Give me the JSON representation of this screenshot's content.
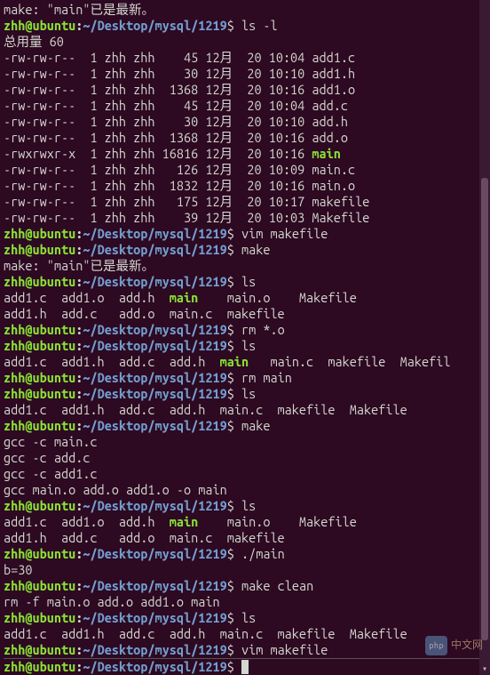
{
  "prompt": {
    "user": "zhh",
    "host": "ubuntu",
    "path": "~/Desktop/mysql/1219",
    "symbol": "$"
  },
  "make_msg": "make: \"main\"已是最新。",
  "ls_total": "总用量 60",
  "ls_l_rows": [
    {
      "perm": "-rw-rw-r--",
      "links": 1,
      "owner": "zhh",
      "group": "zhh",
      "size": "45",
      "month": "12月",
      "day": "20",
      "time": "10:04",
      "name": "add1.c",
      "exec": false
    },
    {
      "perm": "-rw-rw-r--",
      "links": 1,
      "owner": "zhh",
      "group": "zhh",
      "size": "30",
      "month": "12月",
      "day": "20",
      "time": "10:10",
      "name": "add1.h",
      "exec": false
    },
    {
      "perm": "-rw-rw-r--",
      "links": 1,
      "owner": "zhh",
      "group": "zhh",
      "size": "1368",
      "month": "12月",
      "day": "20",
      "time": "10:16",
      "name": "add1.o",
      "exec": false
    },
    {
      "perm": "-rw-rw-r--",
      "links": 1,
      "owner": "zhh",
      "group": "zhh",
      "size": "45",
      "month": "12月",
      "day": "20",
      "time": "10:04",
      "name": "add.c",
      "exec": false
    },
    {
      "perm": "-rw-rw-r--",
      "links": 1,
      "owner": "zhh",
      "group": "zhh",
      "size": "30",
      "month": "12月",
      "day": "20",
      "time": "10:10",
      "name": "add.h",
      "exec": false
    },
    {
      "perm": "-rw-rw-r--",
      "links": 1,
      "owner": "zhh",
      "group": "zhh",
      "size": "1368",
      "month": "12月",
      "day": "20",
      "time": "10:16",
      "name": "add.o",
      "exec": false
    },
    {
      "perm": "-rwxrwxr-x",
      "links": 1,
      "owner": "zhh",
      "group": "zhh",
      "size": "16816",
      "month": "12月",
      "day": "20",
      "time": "10:16",
      "name": "main",
      "exec": true
    },
    {
      "perm": "-rw-rw-r--",
      "links": 1,
      "owner": "zhh",
      "group": "zhh",
      "size": "126",
      "month": "12月",
      "day": "20",
      "time": "10:09",
      "name": "main.c",
      "exec": false
    },
    {
      "perm": "-rw-rw-r--",
      "links": 1,
      "owner": "zhh",
      "group": "zhh",
      "size": "1832",
      "month": "12月",
      "day": "20",
      "time": "10:16",
      "name": "main.o",
      "exec": false
    },
    {
      "perm": "-rw-rw-r--",
      "links": 1,
      "owner": "zhh",
      "group": "zhh",
      "size": "175",
      "month": "12月",
      "day": "20",
      "time": "10:17",
      "name": "makefile",
      "exec": false
    },
    {
      "perm": "-rw-rw-r--",
      "links": 1,
      "owner": "zhh",
      "group": "zhh",
      "size": "39",
      "month": "12月",
      "day": "20",
      "time": "10:03",
      "name": "Makefile",
      "exec": false
    }
  ],
  "cmds": {
    "ls_l": "ls -l",
    "vim_makefile": "vim makefile",
    "make": "make",
    "ls": "ls",
    "rm_o": "rm *.o",
    "rm_main": "rm main",
    "run_main": "./main",
    "make_clean": "make clean"
  },
  "ls_out": {
    "ls1_l1": "add1.c  add1.o  add.h  main    main.o    Makefile",
    "ls1_l2": "add1.h  add.c   add.o  main.c  makefile",
    "ls2": "add1.c  add1.h  add.c  add.h  main  main.c  makefile  Makefil",
    "ls3": "add1.c  add1.h  add.c  add.h  main.c  makefile  Makefile",
    "ls5_l1": "add1.c  add1.o  add.h  main    main.o    Makefile",
    "ls5_l2": "add1.h  add.c   add.o  main.c  makefile",
    "ls6": "add1.c  add1.h  add.c  add.h  main.c  makefile  Makefile"
  },
  "gcc_out": {
    "l1": "gcc -c main.c",
    "l2": "gcc -c add.c",
    "l3": "gcc -c add1.c",
    "l4": "gcc main.o add.o add1.o -o main"
  },
  "run_out": "b=30",
  "clean_out": "rm -f main.o add.o add1.o main",
  "watermark": {
    "icon": "php",
    "text": "中文网"
  }
}
